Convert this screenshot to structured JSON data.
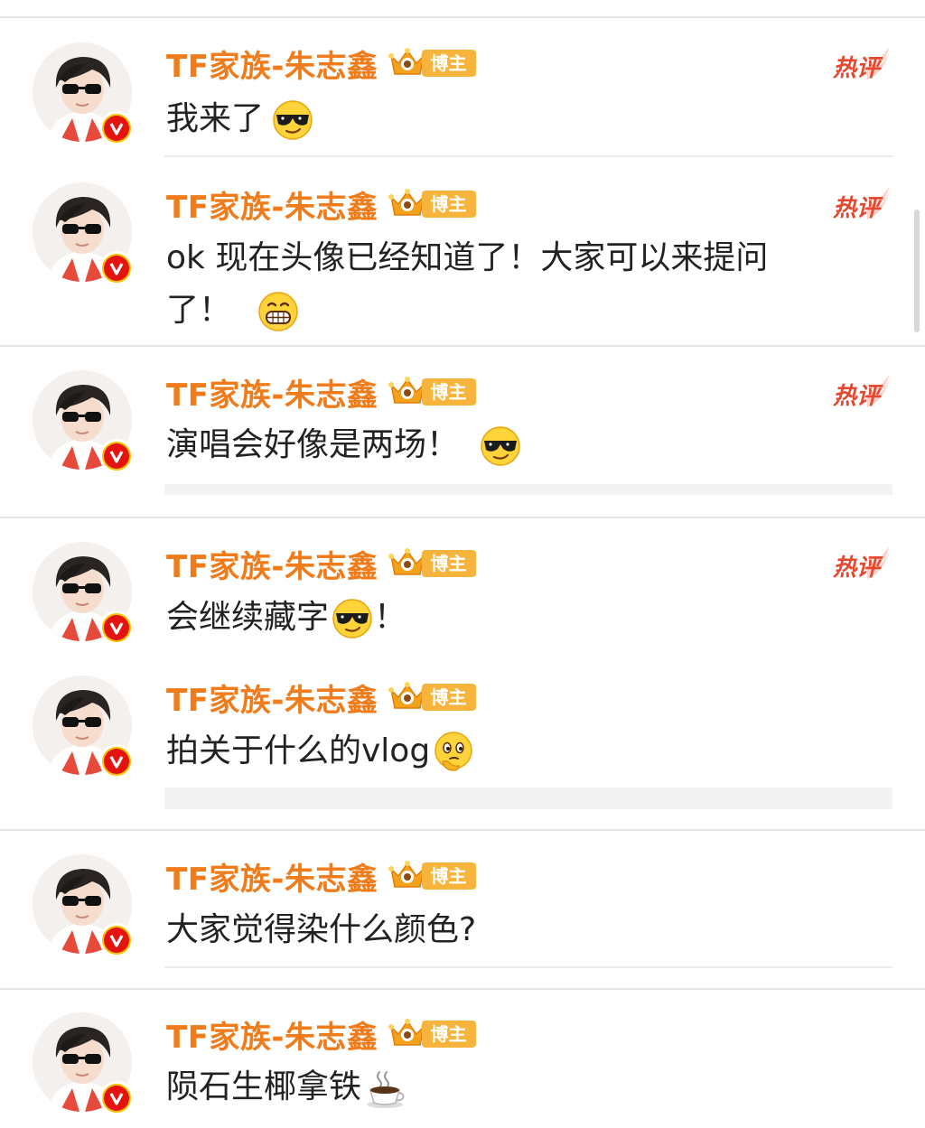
{
  "comments": [
    {
      "author": "TF家族-朱志鑫",
      "badge": "博主",
      "hot_label": "热评",
      "text": "我来了",
      "emoji": "cool-sunglasses"
    },
    {
      "author": "TF家族-朱志鑫",
      "badge": "博主",
      "hot_label": "热评",
      "text": "ok 现在头像已经知道了！大家可以来提问了！",
      "text_line1": "ok 现在头像已经知道了！大家可以来提问",
      "text_line2": "了！",
      "emoji": "big-grin"
    },
    {
      "author": "TF家族-朱志鑫",
      "badge": "博主",
      "hot_label": "热评",
      "text": "演唱会好像是两场！",
      "emoji": "cool-sunglasses"
    },
    {
      "author": "TF家族-朱志鑫",
      "badge": "博主",
      "hot_label": "热评",
      "text": "会继续藏字",
      "text_after": "！",
      "emoji": "cool-sunglasses"
    },
    {
      "author": "TF家族-朱志鑫",
      "badge": "博主",
      "text": "拍关于什么的vlog",
      "emoji": "thinking"
    },
    {
      "author": "TF家族-朱志鑫",
      "badge": "博主",
      "text": "大家觉得染什么颜色?"
    },
    {
      "author": "TF家族-朱志鑫",
      "badge": "博主",
      "text": "陨石生椰拿铁",
      "emoji": "coffee-cup"
    }
  ],
  "colors": {
    "author": "#f07b1a",
    "hot": "#e5482e",
    "badge": "#f7b43c",
    "verified": "#e3140e"
  }
}
